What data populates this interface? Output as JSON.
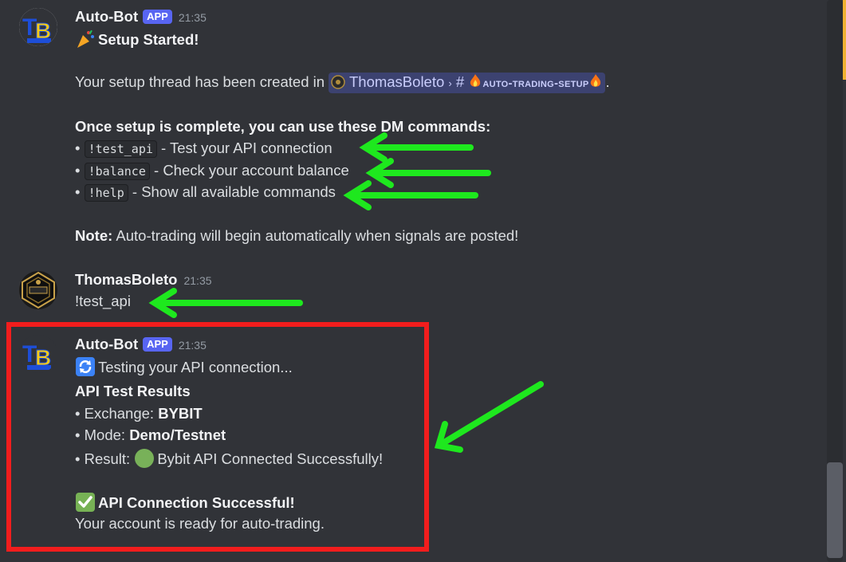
{
  "colors": {
    "background": "#313338",
    "accent_badge": "#5865f2",
    "highlight_border": "#f21d1d",
    "annotation_arrow": "#1ee81e"
  },
  "messages": [
    {
      "author": "Auto-Bot",
      "badge": "APP",
      "time": "21:35",
      "avatar_icon": "tb-logo",
      "title_emoji": "party-popper-icon",
      "title": "Setup Started!",
      "thread_text": "Your setup thread has been created in",
      "thread_server": "ThomasBoleto",
      "thread_sep": "›",
      "thread_hash": "#",
      "thread_channel": "auto-trading-setup",
      "thread_end": ".",
      "commands_heading": "Once setup is complete, you can use these DM commands:",
      "commands": [
        {
          "bullet": "•",
          "code": "!test_api",
          "desc": "- Test your API connection"
        },
        {
          "bullet": "•",
          "code": "!balance",
          "desc": "- Check your account balance"
        },
        {
          "bullet": "•",
          "code": "!help",
          "desc": "- Show all available commands"
        }
      ],
      "note_label": "Note:",
      "note_text": "Auto-trading will begin automatically when signals are posted!"
    },
    {
      "author": "ThomasBoleto",
      "time": "21:35",
      "avatar_icon": "kings-crest-avatar",
      "text": "!test_api"
    },
    {
      "author": "Auto-Bot",
      "badge": "APP",
      "time": "21:35",
      "avatar_icon": "tb-logo",
      "testing_emoji": "arrows-cycle-icon",
      "testing_text": "Testing your API connection...",
      "results_heading": "API Test Results",
      "exchange_label": "• Exchange:",
      "exchange_value": "BYBIT",
      "mode_label": "• Mode:",
      "mode_value": "Demo/Testnet",
      "result_label": "• Result:",
      "result_emoji": "green-circle-icon",
      "result_value": "Bybit API Connected Successfully!",
      "success_emoji": "check-mark-button-icon",
      "success_title": "API Connection Successful!",
      "ready_text": "Your account is ready for auto-trading."
    }
  ]
}
